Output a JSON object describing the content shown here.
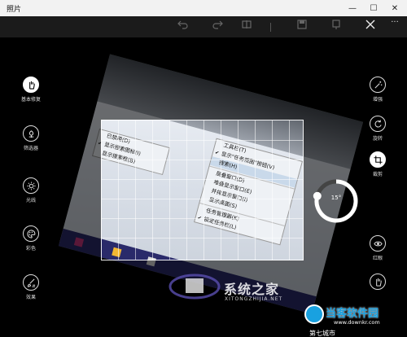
{
  "window": {
    "title": "照片",
    "minimize_glyph": "—",
    "maximize_glyph": "☐",
    "close_glyph": "✕"
  },
  "toolbar": {
    "icons": [
      "undo-icon",
      "redo-icon",
      "save-copy-icon",
      "save-icon",
      "close-icon",
      "more-icon"
    ],
    "more_glyph": "···"
  },
  "left_panel": {
    "items": [
      {
        "label": "基本修复",
        "icon": "hand-icon",
        "active": true
      },
      {
        "label": "筛选器",
        "icon": "flower-icon",
        "active": false
      },
      {
        "label": "光线",
        "icon": "sun-icon",
        "active": false
      },
      {
        "label": "彩色",
        "icon": "palette-icon",
        "active": false
      },
      {
        "label": "效果",
        "icon": "brush-icon",
        "active": false
      }
    ]
  },
  "right_panel": {
    "items": [
      {
        "label": "增强",
        "icon": "wand-icon"
      },
      {
        "label": "旋转",
        "icon": "rotate-icon"
      },
      {
        "label": "裁剪",
        "icon": "crop-icon"
      },
      {
        "label": "红眼",
        "icon": "eye-icon"
      },
      {
        "label": "",
        "icon": "hand-icon"
      }
    ]
  },
  "rotation": {
    "angle_label": "15°",
    "angle_degrees": 15
  },
  "photo_menu_left": {
    "items": [
      {
        "label": "已禁用(D)",
        "checked": false
      },
      {
        "label": "显示搜索图标(I)",
        "checked": true
      },
      {
        "label": "显示搜索框(B)",
        "checked": false
      }
    ]
  },
  "photo_menu_right": {
    "items": [
      {
        "label": "工具栏(T)",
        "checked": false
      },
      {
        "label": "显示\"任务视图\"按钮(V)",
        "checked": true
      },
      {
        "label": "搜索(H)",
        "checked": false,
        "highlight": true
      },
      {
        "label": "层叠窗口(D)",
        "checked": false
      },
      {
        "label": "堆叠显示窗口(E)",
        "checked": false
      },
      {
        "label": "并排显示窗口(I)",
        "checked": false
      },
      {
        "label": "显示桌面(S)",
        "checked": false
      },
      {
        "label": "任务管理器(K)",
        "checked": false
      },
      {
        "label": "锁定任务栏(L)",
        "checked": true
      }
    ]
  },
  "watermarks": {
    "site1_cn": "系统之家",
    "site1_en": "XITONGZHIJIA.NET",
    "site2_cn": "当客软件园",
    "site2_url": "www.downkr.com",
    "site3": "第七城市"
  }
}
